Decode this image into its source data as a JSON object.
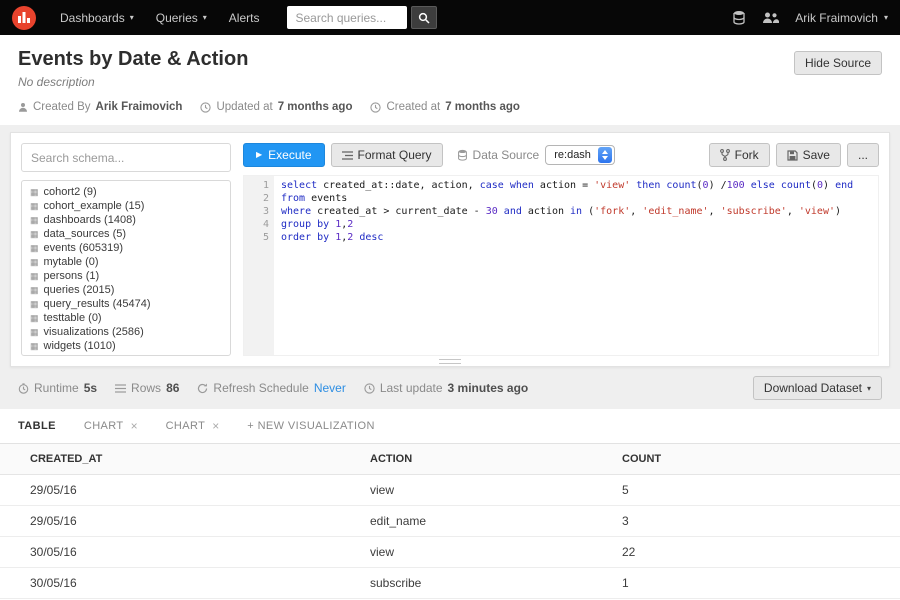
{
  "icons": {
    "caret_down": "▾",
    "close": "×",
    "play": "▶",
    "table_grid": "▦"
  },
  "navbar": {
    "menus": [
      {
        "label": "Dashboards"
      },
      {
        "label": "Queries"
      },
      {
        "label": "Alerts"
      }
    ],
    "search_placeholder": "Search queries...",
    "user_name": "Arik Fraimovich"
  },
  "header": {
    "title": "Events by Date & Action",
    "description": "No description",
    "created_by_label": "Created By",
    "created_by_value": "Arik Fraimovich",
    "updated_label": "Updated at",
    "updated_value": "7 months ago",
    "created_label": "Created at",
    "created_value": "7 months ago",
    "hide_source_label": "Hide Source"
  },
  "schema": {
    "search_placeholder": "Search schema...",
    "tables": [
      "cohort2 (9)",
      "cohort_example (15)",
      "dashboards (1408)",
      "data_sources (5)",
      "events (605319)",
      "mytable (0)",
      "persons (1)",
      "queries (2015)",
      "query_results (45474)",
      "testtable (0)",
      "visualizations (2586)",
      "widgets (1010)"
    ]
  },
  "toolbar": {
    "execute_label": "Execute",
    "format_label": "Format Query",
    "datasource_label": "Data Source",
    "datasource_value": "re:dash",
    "fork_label": "Fork",
    "save_label": "Save",
    "more_label": "..."
  },
  "editor": {
    "lines": [
      [
        {
          "c": "kw",
          "t": "select"
        },
        {
          "c": "",
          "t": " created_at::date, action, "
        },
        {
          "c": "kw",
          "t": "case"
        },
        {
          "c": "",
          "t": " "
        },
        {
          "c": "kw",
          "t": "when"
        },
        {
          "c": "",
          "t": " action = "
        },
        {
          "c": "str",
          "t": "'view'"
        },
        {
          "c": "",
          "t": " "
        },
        {
          "c": "kw",
          "t": "then"
        },
        {
          "c": "",
          "t": " "
        },
        {
          "c": "fn",
          "t": "count"
        },
        {
          "c": "",
          "t": "("
        },
        {
          "c": "num",
          "t": "0"
        },
        {
          "c": "",
          "t": ") /"
        },
        {
          "c": "num",
          "t": "100"
        },
        {
          "c": "",
          "t": " "
        },
        {
          "c": "kw",
          "t": "else"
        },
        {
          "c": "",
          "t": " "
        },
        {
          "c": "fn",
          "t": "count"
        },
        {
          "c": "",
          "t": "("
        },
        {
          "c": "num",
          "t": "0"
        },
        {
          "c": "",
          "t": ") "
        },
        {
          "c": "kw",
          "t": "end"
        }
      ],
      [
        {
          "c": "kw",
          "t": "from"
        },
        {
          "c": "",
          "t": " events"
        }
      ],
      [
        {
          "c": "kw",
          "t": "where"
        },
        {
          "c": "",
          "t": " created_at > current_date - "
        },
        {
          "c": "num",
          "t": "30"
        },
        {
          "c": "",
          "t": " "
        },
        {
          "c": "kw",
          "t": "and"
        },
        {
          "c": "",
          "t": " action "
        },
        {
          "c": "kw",
          "t": "in"
        },
        {
          "c": "",
          "t": " ("
        },
        {
          "c": "str",
          "t": "'fork'"
        },
        {
          "c": "",
          "t": ", "
        },
        {
          "c": "str",
          "t": "'edit_name'"
        },
        {
          "c": "",
          "t": ", "
        },
        {
          "c": "str",
          "t": "'subscribe'"
        },
        {
          "c": "",
          "t": ", "
        },
        {
          "c": "str",
          "t": "'view'"
        },
        {
          "c": "",
          "t": ")"
        }
      ],
      [
        {
          "c": "kw",
          "t": "group"
        },
        {
          "c": "",
          "t": " "
        },
        {
          "c": "kw",
          "t": "by"
        },
        {
          "c": "",
          "t": " "
        },
        {
          "c": "num",
          "t": "1"
        },
        {
          "c": "",
          "t": ","
        },
        {
          "c": "num",
          "t": "2"
        }
      ],
      [
        {
          "c": "kw",
          "t": "order"
        },
        {
          "c": "",
          "t": " "
        },
        {
          "c": "kw",
          "t": "by"
        },
        {
          "c": "",
          "t": " "
        },
        {
          "c": "num",
          "t": "1"
        },
        {
          "c": "",
          "t": ","
        },
        {
          "c": "num",
          "t": "2"
        },
        {
          "c": "",
          "t": " "
        },
        {
          "c": "kw",
          "t": "desc"
        }
      ]
    ]
  },
  "status": {
    "runtime_label": "Runtime",
    "runtime_value": "5s",
    "rows_label": "Rows",
    "rows_value": "86",
    "refresh_label": "Refresh Schedule",
    "refresh_value": "Never",
    "last_update_label": "Last update",
    "last_update_value": "3 minutes ago",
    "download_label": "Download Dataset"
  },
  "viz": {
    "tabs": [
      {
        "label": "TABLE"
      },
      {
        "label": "CHART"
      },
      {
        "label": "CHART"
      },
      {
        "label": "+ NEW VISUALIZATION"
      }
    ]
  },
  "table": {
    "headers": [
      "CREATED_AT",
      "ACTION",
      "COUNT"
    ],
    "rows": [
      [
        "29/05/16",
        "view",
        "5"
      ],
      [
        "29/05/16",
        "edit_name",
        "3"
      ],
      [
        "30/05/16",
        "view",
        "22"
      ],
      [
        "30/05/16",
        "subscribe",
        "1"
      ]
    ]
  }
}
